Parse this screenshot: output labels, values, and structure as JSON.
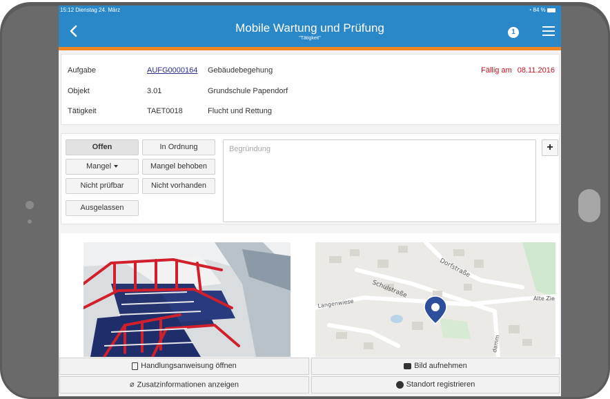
{
  "status_bar": {
    "time_date": "15:12  Dienstag 24. März",
    "battery": "84 %"
  },
  "header": {
    "title": "Mobile Wartung und Prüfung",
    "subtitle": "\"Tätigkeit\"",
    "notification_count": "1"
  },
  "info": {
    "rows": [
      {
        "label": "Aufgabe",
        "code": "AUFG0000164",
        "value": "Gebäudebegehung"
      },
      {
        "label": "Objekt",
        "code": "3.01",
        "value": "Grundschule Papendorf"
      },
      {
        "label": "Tätigkeit",
        "code": "TAET0018",
        "value": "Flucht und Rettung"
      }
    ],
    "due_label": "Fällig am",
    "due_date": "08.11.2016"
  },
  "status_buttons": {
    "offen": "Offen",
    "in_ordnung": "In Ordnung",
    "mangel": "Mangel",
    "mangel_behoben": "Mangel behoben",
    "nicht_pruefbar": "Nicht prüfbar",
    "nicht_vorhanden": "Nicht vorhanden",
    "ausgelassen": "Ausgelassen",
    "active": "Offen"
  },
  "reason": {
    "placeholder": "Begründung",
    "add_label": "+"
  },
  "map": {
    "streets": [
      "Dorfstraße",
      "Schulstraße",
      "Langenwiese",
      "Alte Zie",
      "damm"
    ]
  },
  "actions": {
    "instructions": "Handlungsanweisung öffnen",
    "take_photo": "Bild aufnehmen",
    "additional_info": "Zusatzinformationen anzeigen",
    "register_location": "Standort registrieren"
  },
  "colors": {
    "header_blue": "#2a88c9",
    "accent_orange": "#f08526",
    "due_red": "#c1121f",
    "link_blue": "#2d2d8f",
    "map_pin": "#2e4f9c"
  }
}
